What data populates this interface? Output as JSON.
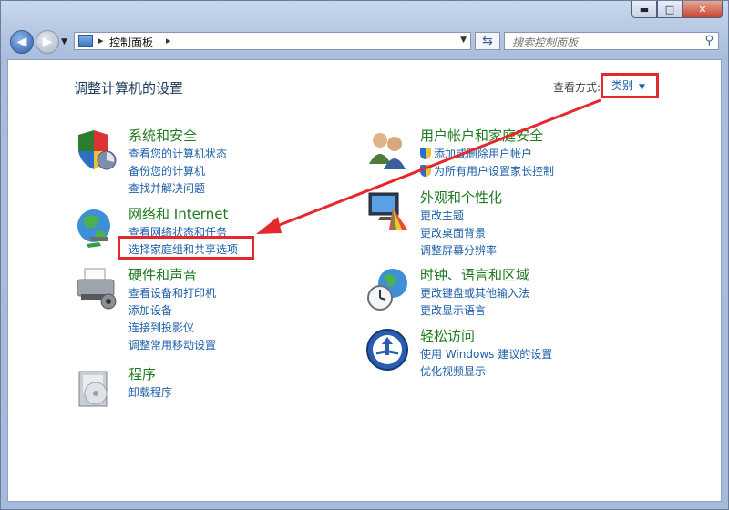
{
  "window": {
    "title_controls": {
      "minimize": "▬",
      "maximize": "□",
      "close": "✕"
    }
  },
  "address": {
    "crumb": "控制面板",
    "separator": "▸"
  },
  "search": {
    "placeholder": "搜索控制面板"
  },
  "header": {
    "title": "调整计算机的设置",
    "view_by_label": "查看方式:",
    "view_by_value": "类别"
  },
  "categories": [
    {
      "title": "系统和安全",
      "icon": "shield-system-icon",
      "links": [
        "查看您的计算机状态",
        "备份您的计算机",
        "查找并解决问题"
      ]
    },
    {
      "title": "网络和 Internet",
      "icon": "network-globe-icon",
      "links": [
        "查看网络状态和任务",
        "选择家庭组和共享选项"
      ]
    },
    {
      "title": "硬件和声音",
      "icon": "printer-icon",
      "links": [
        "查看设备和打印机",
        "添加设备",
        "连接到投影仪",
        "调整常用移动设置"
      ]
    },
    {
      "title": "程序",
      "icon": "programs-icon",
      "links": [
        "卸载程序"
      ]
    },
    {
      "title": "用户帐户和家庭安全",
      "icon": "users-icon",
      "links": [
        "添加或删除用户帐户",
        "为所有用户设置家长控制"
      ]
    },
    {
      "title": "外观和个性化",
      "icon": "display-palette-icon",
      "links": [
        "更改主题",
        "更改桌面背景",
        "调整屏幕分辨率"
      ]
    },
    {
      "title": "时钟、语言和区域",
      "icon": "clock-globe-icon",
      "links": [
        "更改键盘或其他输入法",
        "更改显示语言"
      ]
    },
    {
      "title": "轻松访问",
      "icon": "ease-of-access-icon",
      "links": [
        "使用 Windows 建议的设置",
        "优化视频显示"
      ]
    }
  ],
  "colors": {
    "link": "#1e5fa8",
    "category_title": "#1f7a1f",
    "annotation": "#e5282c"
  }
}
